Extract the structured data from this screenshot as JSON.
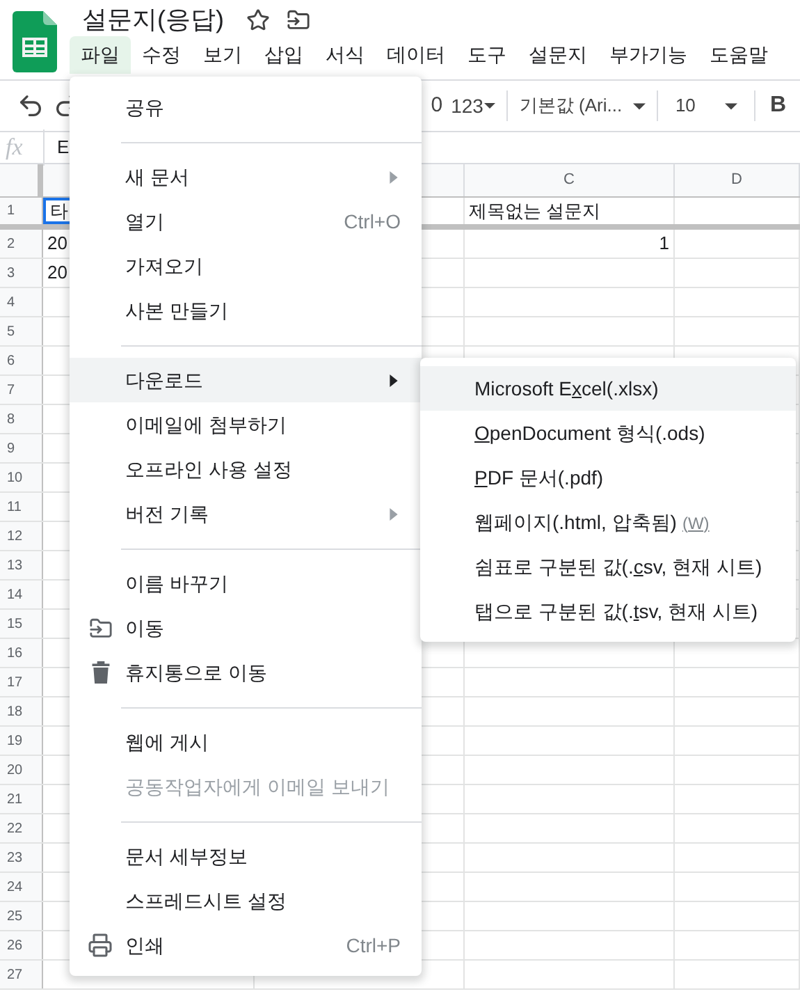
{
  "document": {
    "title": "설문지(응답)"
  },
  "menu_bar": [
    {
      "label": "파일",
      "selected": true
    },
    {
      "label": "수정",
      "selected": false
    },
    {
      "label": "보기",
      "selected": false
    },
    {
      "label": "삽입",
      "selected": false
    },
    {
      "label": "서식",
      "selected": false
    },
    {
      "label": "데이터",
      "selected": false
    },
    {
      "label": "도구",
      "selected": false
    },
    {
      "label": "설문지",
      "selected": false
    },
    {
      "label": "부가기능",
      "selected": false
    },
    {
      "label": "도움말",
      "selected": false
    }
  ],
  "toolbar": {
    "decimal": "0",
    "number_format": "123",
    "font": "기본값 (Ari...",
    "font_size": "10",
    "bold": "B"
  },
  "formula_bar": {
    "label": "fx",
    "value": "E"
  },
  "sheet": {
    "columns": [
      "C",
      "D"
    ],
    "rows": [
      {
        "number": "1",
        "col_a": {
          "text": "타",
          "selected": true
        },
        "col_c": {
          "text": "제목없는 설문지",
          "kind": "text",
          "selected": false
        }
      },
      {
        "number": "2",
        "col_a": {
          "text": "20",
          "selected": false
        },
        "col_c": {
          "text": "1",
          "kind": "number",
          "selected": false
        }
      },
      {
        "number": "3",
        "col_a": {
          "text": "20",
          "selected": false
        }
      },
      {
        "number": "4"
      },
      {
        "number": "5"
      },
      {
        "number": "6"
      },
      {
        "number": "7"
      },
      {
        "number": "8"
      },
      {
        "number": "9"
      },
      {
        "number": "10"
      },
      {
        "number": "11"
      },
      {
        "number": "12"
      },
      {
        "number": "13"
      },
      {
        "number": "14"
      },
      {
        "number": "15"
      },
      {
        "number": "16"
      },
      {
        "number": "17"
      },
      {
        "number": "18"
      },
      {
        "number": "19"
      },
      {
        "number": "20"
      },
      {
        "number": "21"
      },
      {
        "number": "22"
      },
      {
        "number": "23"
      },
      {
        "number": "24"
      },
      {
        "number": "25"
      },
      {
        "number": "26"
      },
      {
        "number": "27"
      }
    ]
  },
  "file_menu": [
    {
      "kind": "item",
      "label": "공유",
      "selected": false,
      "disabled": false
    },
    {
      "kind": "separator"
    },
    {
      "kind": "item",
      "label": "새 문서",
      "has_submenu": true,
      "selected": false,
      "disabled": false
    },
    {
      "kind": "item",
      "label": "열기",
      "shortcut": "Ctrl+O",
      "selected": false,
      "disabled": false
    },
    {
      "kind": "item",
      "label": "가져오기",
      "selected": false,
      "disabled": false
    },
    {
      "kind": "item",
      "label": "사본 만들기",
      "selected": false,
      "disabled": false
    },
    {
      "kind": "separator"
    },
    {
      "kind": "item",
      "label": "다운로드",
      "has_submenu": true,
      "selected": true,
      "disabled": false
    },
    {
      "kind": "item",
      "label": "이메일에 첨부하기",
      "selected": false,
      "disabled": false
    },
    {
      "kind": "item",
      "label": "오프라인 사용 설정",
      "selected": false,
      "disabled": false
    },
    {
      "kind": "item",
      "label": "버전 기록",
      "has_submenu": true,
      "selected": false,
      "disabled": false
    },
    {
      "kind": "separator"
    },
    {
      "kind": "item",
      "label": "이름 바꾸기",
      "selected": false,
      "disabled": false
    },
    {
      "kind": "move",
      "label": "이동",
      "selected": false,
      "disabled": false
    },
    {
      "kind": "trash",
      "label": "휴지통으로 이동",
      "selected": false,
      "disabled": false
    },
    {
      "kind": "separator"
    },
    {
      "kind": "item",
      "label": "웹에 게시",
      "selected": false,
      "disabled": false
    },
    {
      "kind": "item",
      "label": "공동작업자에게 이메일 보내기",
      "selected": false,
      "disabled": true
    },
    {
      "kind": "separator"
    },
    {
      "kind": "item",
      "label": "문서 세부정보",
      "selected": false,
      "disabled": false
    },
    {
      "kind": "item",
      "label": "스프레드시트 설정",
      "selected": false,
      "disabled": false
    },
    {
      "kind": "print",
      "label": "인쇄",
      "shortcut": "Ctrl+P",
      "selected": false,
      "disabled": false
    }
  ],
  "download_menu": [
    {
      "before": "Microsoft E",
      "mnemonic": "x",
      "after": "cel(.xlsx)",
      "selected": true
    },
    {
      "mnemonic": "O",
      "after": "penDocument 형식(.ods)",
      "selected": false
    },
    {
      "mnemonic": "P",
      "after": "DF 문서(.pdf)",
      "selected": false
    },
    {
      "before": "웹페이지(.html, 압축됨)",
      "hint": "(W)",
      "selected": false
    },
    {
      "before": "쉼표로 구분된 값(.",
      "mnemonic": "c",
      "after": "sv, 현재 시트)",
      "selected": false
    },
    {
      "before": "탭으로 구분된 값(.",
      "mnemonic": "t",
      "after": "sv, 현재 시트)",
      "selected": false
    }
  ]
}
